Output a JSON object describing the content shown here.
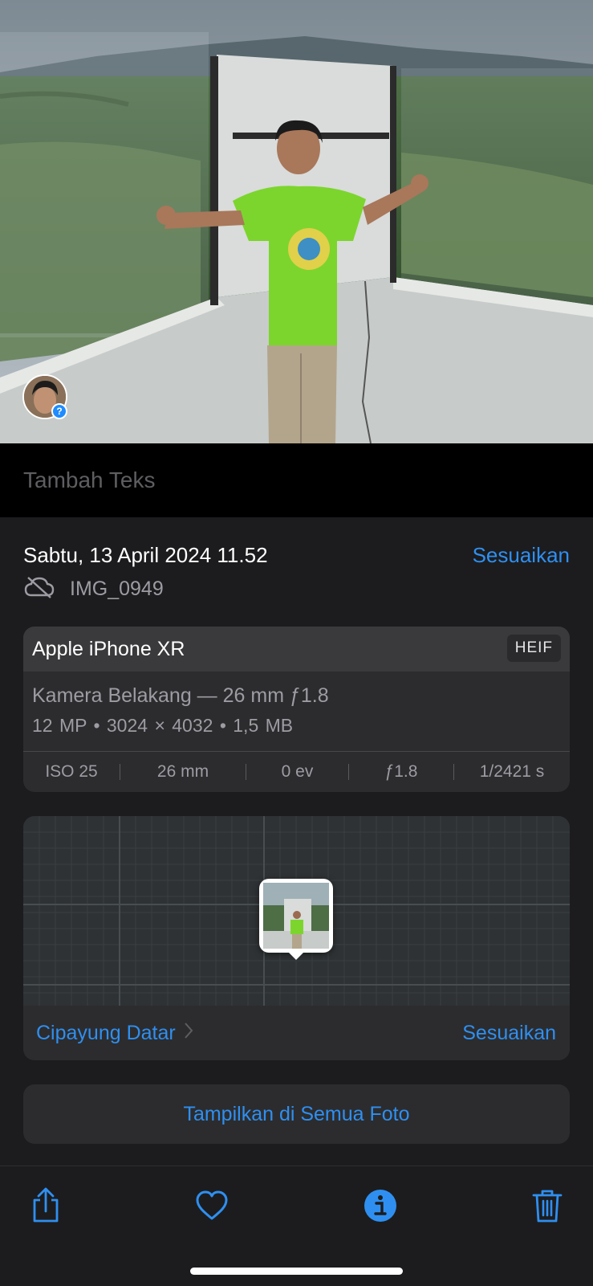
{
  "photo": {
    "description_icon": "person-face-badge",
    "face_badge_glyph": "?"
  },
  "caption": {
    "placeholder": "Tambah Teks"
  },
  "meta": {
    "date": "Sabtu, 13 April 2024 11.52",
    "adjust_label": "Sesuaikan",
    "cloud_icon": "cloud-slash-icon",
    "filename": "IMG_0949"
  },
  "camera": {
    "model": "Apple iPhone XR",
    "format": "HEIF",
    "lens": "Kamera Belakang — 26 mm ƒ1.8",
    "specs": "12 MP  •  3024 × 4032  •  1,5 MB",
    "exif": {
      "iso": "ISO 25",
      "focal": "26 mm",
      "ev": "0 ev",
      "aperture": "ƒ1.8",
      "shutter": "1/2421 s"
    }
  },
  "map": {
    "location": "Cipayung Datar",
    "adjust_label": "Sesuaikan"
  },
  "show_all": {
    "label": "Tampilkan di Semua Foto"
  },
  "toolbar": {
    "share_icon": "share-icon",
    "favorite_icon": "heart-icon",
    "info_icon": "info-icon",
    "delete_icon": "trash-icon"
  },
  "colors": {
    "accent": "#2f8ff0",
    "background": "#1c1c1e",
    "card": "#2c2c2e"
  }
}
